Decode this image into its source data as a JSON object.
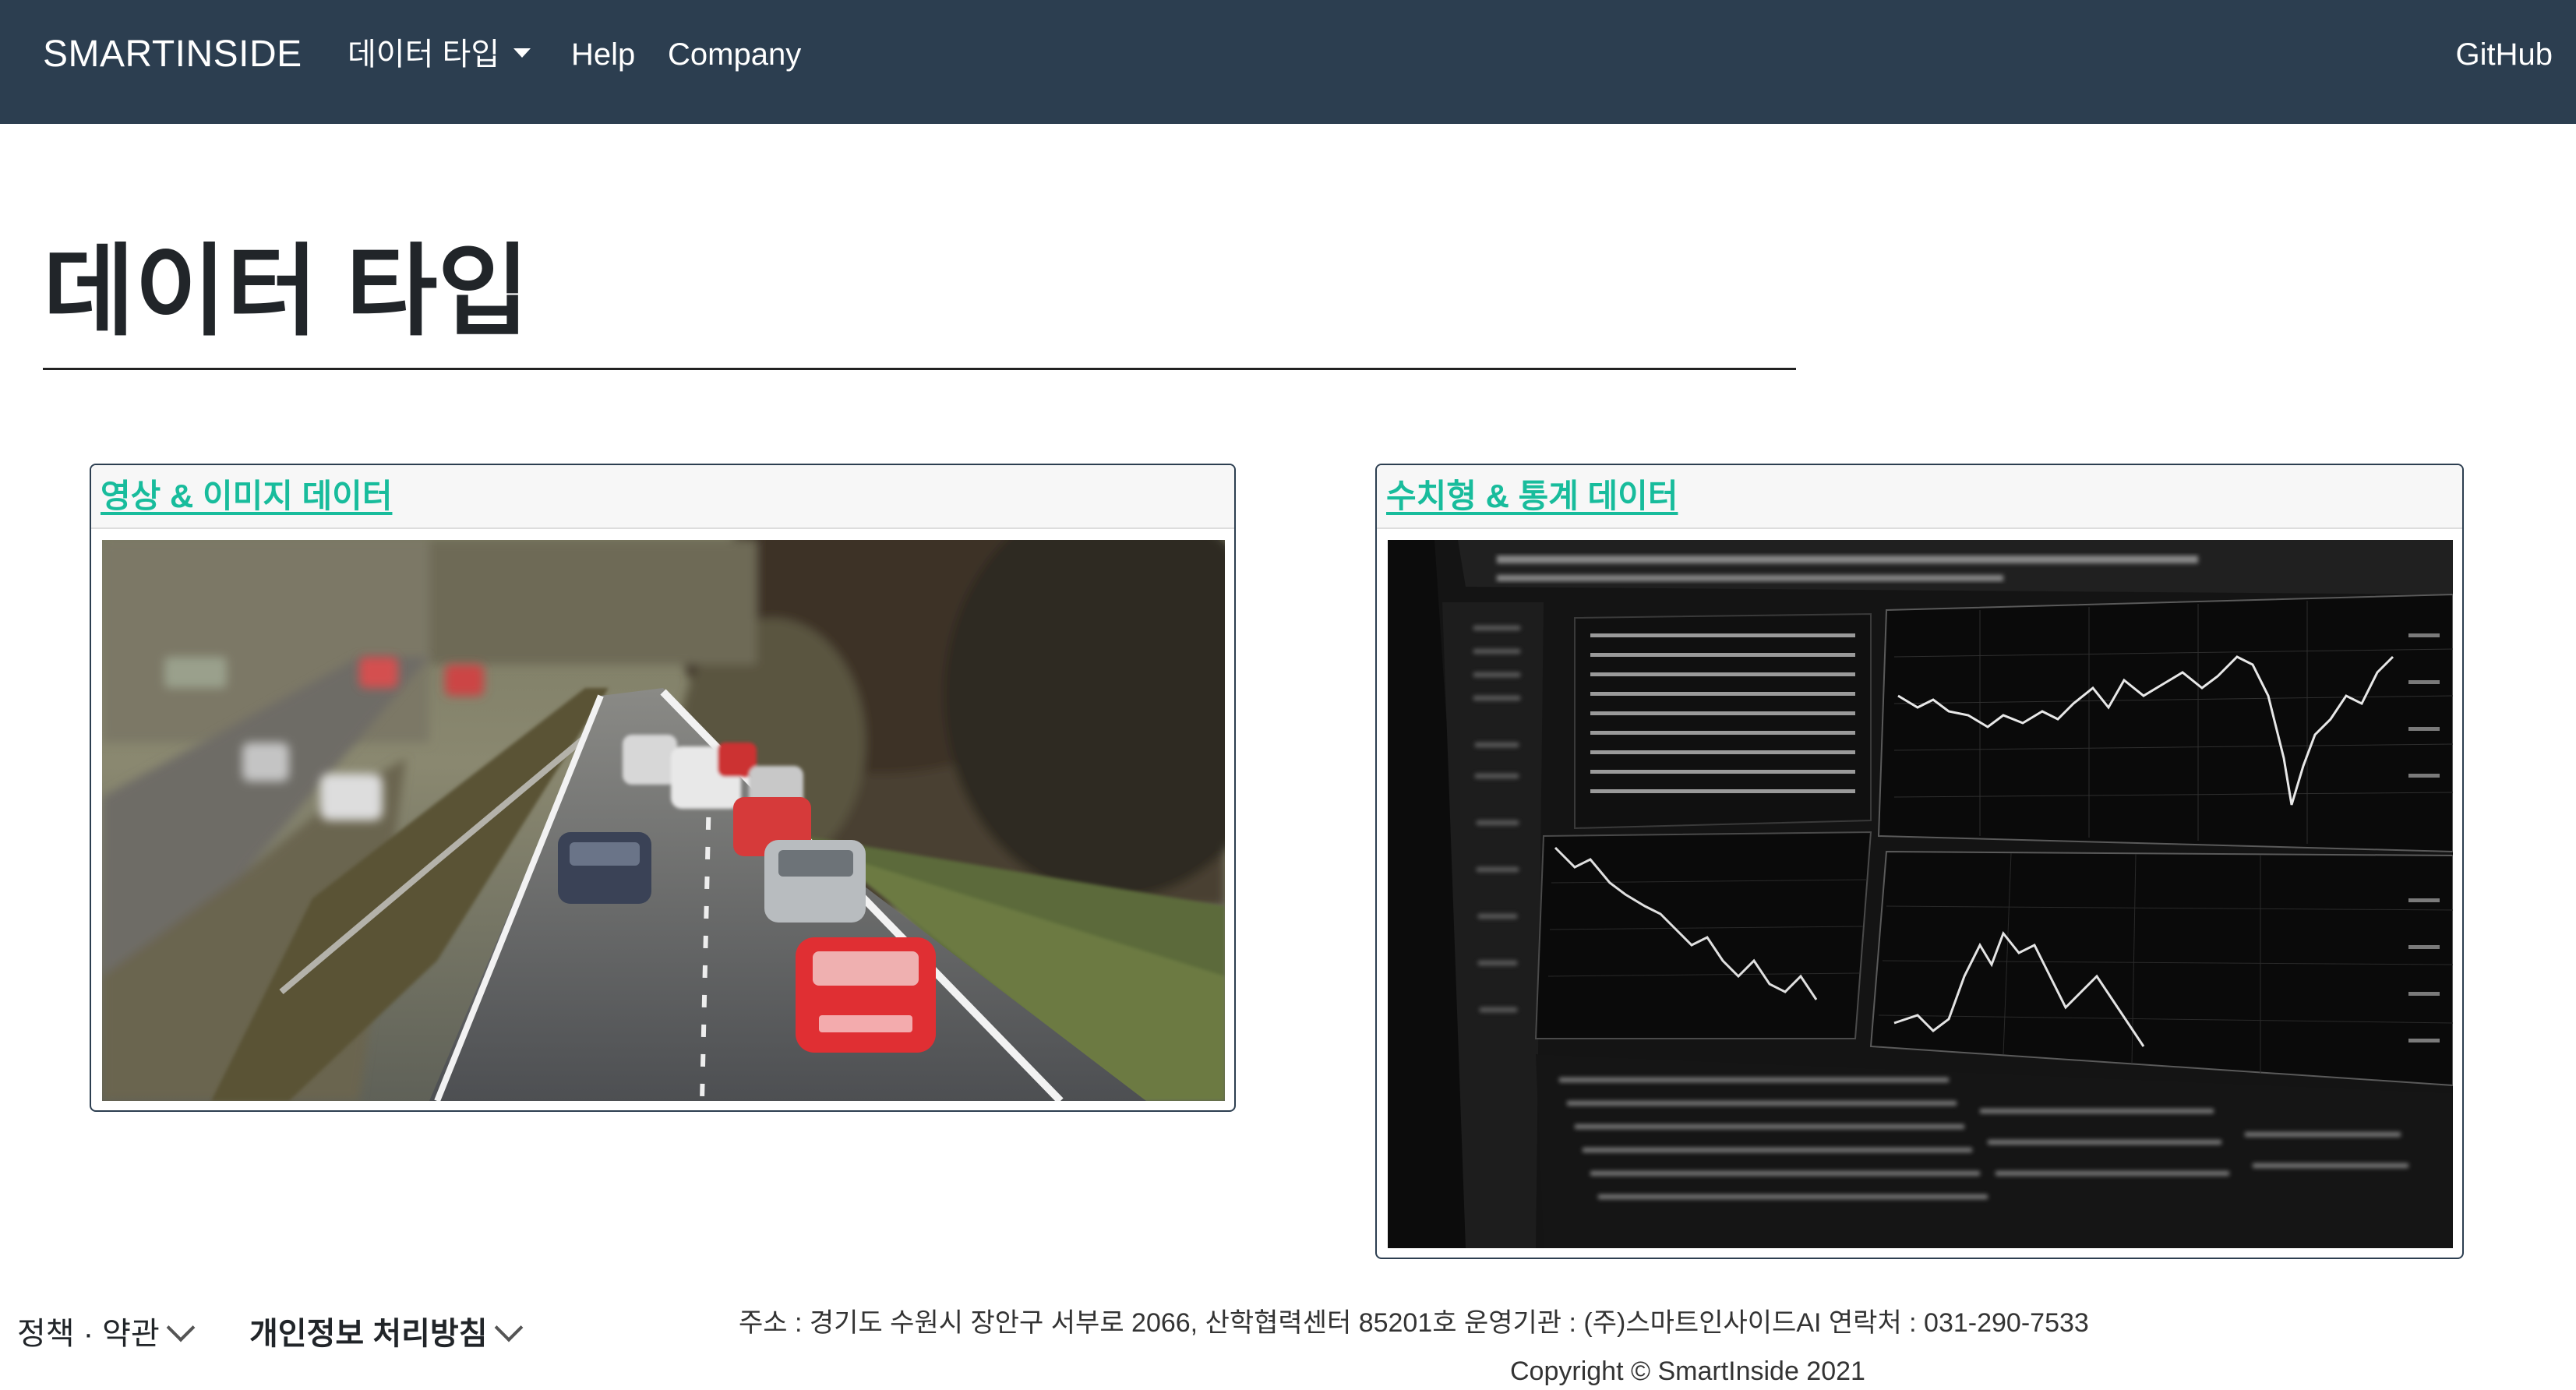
{
  "navbar": {
    "brand": "SMARTINSIDE",
    "dropdown_label": "데이터 타입",
    "help_label": "Help",
    "company_label": "Company",
    "github_label": "GitHub",
    "background_color": "#2c3e50"
  },
  "page": {
    "title": "데이터 타입"
  },
  "cards": [
    {
      "link_label": "영상 & 이미지 데이터",
      "image": "highway-traffic-photo"
    },
    {
      "link_label": "수치형 & 통계 데이터",
      "image": "stock-market-monitor-photo"
    }
  ],
  "footer": {
    "policy_label": "정책 · 약관",
    "privacy_label": "개인정보 처리방침",
    "address": "주소 : 경기도 수원시 장안구 서부로 2066, 산학협력센터 85201호   운영기관 : (주)스마트인사이드AI   연락처 : 031-290-7533",
    "copyright": "Copyright © SmartInside 2021"
  },
  "colors": {
    "link": "#18bc9c",
    "navbar": "#2c3e50"
  }
}
